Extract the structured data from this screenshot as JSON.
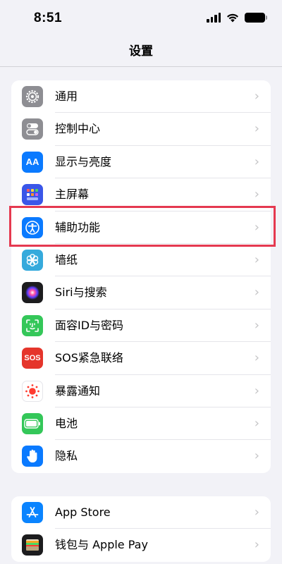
{
  "status_bar": {
    "time": "8:51"
  },
  "nav": {
    "title": "设置"
  },
  "group1": [
    {
      "label": "通用",
      "icon": "gear-icon",
      "color": "#8e8e93"
    },
    {
      "label": "控制中心",
      "icon": "toggles-icon",
      "color": "#8e8e93"
    },
    {
      "label": "显示与亮度",
      "icon": "text-size-icon",
      "icon_text": "AA",
      "color": "#0a7aff"
    },
    {
      "label": "主屏幕",
      "icon": "home-screen-grid-icon",
      "color": "#3a56e8"
    },
    {
      "label": "辅助功能",
      "icon": "accessibility-icon",
      "color": "#0a7aff"
    },
    {
      "label": "墙纸",
      "icon": "flower-icon",
      "color": "#35aadc"
    },
    {
      "label": "Siri与搜索",
      "icon": "siri-icon",
      "color": "#1c1c1e"
    },
    {
      "label": "面容ID与密码",
      "icon": "face-id-icon",
      "color": "#34c759"
    },
    {
      "label": "SOS紧急联络",
      "icon": "sos-icon",
      "icon_text": "SOS",
      "color": "#e5352b"
    },
    {
      "label": "暴露通知",
      "icon": "exposure-notification-icon",
      "color": "#ffffff"
    },
    {
      "label": "电池",
      "icon": "battery-icon",
      "color": "#34c759"
    },
    {
      "label": "隐私",
      "icon": "hand-icon",
      "color": "#0a7aff"
    }
  ],
  "group2": [
    {
      "label": "App Store",
      "icon": "app-store-icon",
      "color": "#0a84ff"
    },
    {
      "label": "钱包与 Apple Pay",
      "icon": "wallet-icon",
      "color": "#1c1c1e"
    }
  ],
  "highlight_color": "#e53950"
}
